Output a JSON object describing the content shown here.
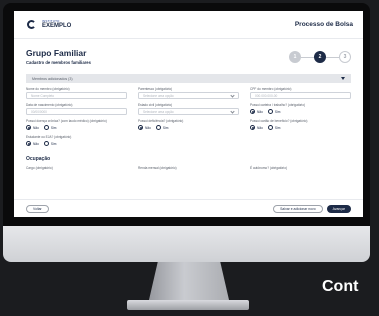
{
  "app": {
    "logo_small": "INSTITUTO",
    "logo_big": "EXEMPLO",
    "title": "Processo de Bolsa"
  },
  "page": {
    "title": "Grupo Familiar",
    "subtitle": "Cadastro de membros familiares"
  },
  "stepper": [
    "1",
    "2",
    "3"
  ],
  "accordion": {
    "label": "Membros adicionados (3)"
  },
  "fields": [
    {
      "label": "Nome do membro (obrigatório)",
      "placeholder": "Nome Completo",
      "type": "text"
    },
    {
      "label": "Parentesco (obrigatório)",
      "placeholder": "Selecione uma opção",
      "type": "select"
    },
    {
      "label": "CPF do membro (obrigatório)",
      "placeholder": "000.000.000-00",
      "type": "text"
    },
    {
      "label": "Data de nascimento (obrigatório)",
      "placeholder": "00/00/0000",
      "type": "text"
    },
    {
      "label": "Estado civil (obrigatório)",
      "placeholder": "Selecione uma opção",
      "type": "select"
    },
    {
      "label": "Possui carteira / trabalho? (obrigatório)",
      "type": "radio",
      "options": [
        "Não",
        "Sim"
      ],
      "selected": 0
    },
    {
      "label": "Possui doença crônica? (com laudo médico) (obrigatório)",
      "type": "radio",
      "options": [
        "Não",
        "Sim"
      ],
      "selected": 0
    },
    {
      "label": "Possui deficiência? (obrigatório)",
      "type": "radio",
      "options": [
        "Não",
        "Sim"
      ],
      "selected": 0
    },
    {
      "label": "Possui cartão de benefício? (obrigatório)",
      "type": "radio",
      "options": [
        "Não",
        "Sim"
      ],
      "selected": 0
    },
    {
      "label": "Estudante ou EJA? (obrigatório)",
      "type": "radio",
      "options": [
        "Não",
        "Sim"
      ],
      "selected": 0
    }
  ],
  "occupation": {
    "title": "Ocupação",
    "fields": [
      {
        "label": "Cargo (obrigatório)"
      },
      {
        "label": "Renda mensal (obrigatório)"
      },
      {
        "label": "É autônomo? (obrigatório)"
      }
    ]
  },
  "footer": {
    "back": "Voltar",
    "add": "Salvar e adicionar novo",
    "next": "Avançar"
  },
  "colors": {
    "primary": "#1d2b47",
    "bezel": "#0a0a0b"
  },
  "overlay_text": "Cont"
}
